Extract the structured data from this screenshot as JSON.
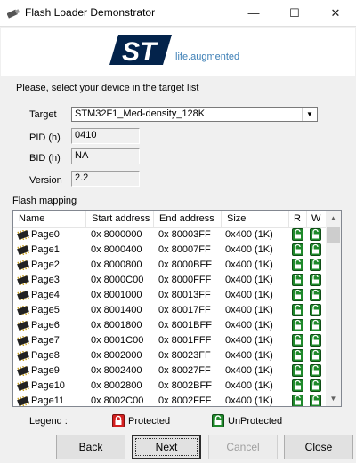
{
  "window": {
    "title": "Flash Loader Demonstrator",
    "app_icon": "usb-drive-icon",
    "min_glyph": "—",
    "max_glyph": "☐",
    "close_glyph": "✕"
  },
  "branding": {
    "logo": "st-logo",
    "tagline": "life.augmented",
    "logo_color": "#03234b",
    "tagline_color": "#3d7fb6"
  },
  "device": {
    "prompt": "Please, select your device in the target list",
    "target_label": "Target",
    "target_value": "STM32F1_Med-density_128K",
    "pid_label": "PID  (h)",
    "pid_value": "0410",
    "bid_label": "BID  (h)",
    "bid_value": "NA",
    "version_label": "Version",
    "version_value": "2.2"
  },
  "flash": {
    "label": "Flash mapping",
    "columns": [
      "Name",
      "Start address",
      "End address",
      "Size",
      "R",
      "W"
    ],
    "rows": [
      {
        "name": "Page0",
        "start": "0x 8000000",
        "end": "0x 80003FF",
        "size": "0x400 (1K)"
      },
      {
        "name": "Page1",
        "start": "0x 8000400",
        "end": "0x 80007FF",
        "size": "0x400 (1K)"
      },
      {
        "name": "Page2",
        "start": "0x 8000800",
        "end": "0x 8000BFF",
        "size": "0x400 (1K)"
      },
      {
        "name": "Page3",
        "start": "0x 8000C00",
        "end": "0x 8000FFF",
        "size": "0x400 (1K)"
      },
      {
        "name": "Page4",
        "start": "0x 8001000",
        "end": "0x 80013FF",
        "size": "0x400 (1K)"
      },
      {
        "name": "Page5",
        "start": "0x 8001400",
        "end": "0x 80017FF",
        "size": "0x400 (1K)"
      },
      {
        "name": "Page6",
        "start": "0x 8001800",
        "end": "0x 8001BFF",
        "size": "0x400 (1K)"
      },
      {
        "name": "Page7",
        "start": "0x 8001C00",
        "end": "0x 8001FFF",
        "size": "0x400 (1K)"
      },
      {
        "name": "Page8",
        "start": "0x 8002000",
        "end": "0x 80023FF",
        "size": "0x400 (1K)"
      },
      {
        "name": "Page9",
        "start": "0x 8002400",
        "end": "0x 80027FF",
        "size": "0x400 (1K)"
      },
      {
        "name": "Page10",
        "start": "0x 8002800",
        "end": "0x 8002BFF",
        "size": "0x400 (1K)"
      },
      {
        "name": "Page11",
        "start": "0x 8002C00",
        "end": "0x 8002FFF",
        "size": "0x400 (1K)"
      }
    ],
    "row_icon": "memory-chip-icon",
    "read_state": "UnProtected",
    "write_state": "UnProtected"
  },
  "legend": {
    "label": "Legend :",
    "protected": "Protected",
    "unprotected": "UnProtected",
    "protected_color": "#d42020",
    "unprotected_color": "#1f8a2b"
  },
  "buttons": {
    "back": "Back",
    "next": "Next",
    "cancel": "Cancel",
    "close": "Close"
  }
}
